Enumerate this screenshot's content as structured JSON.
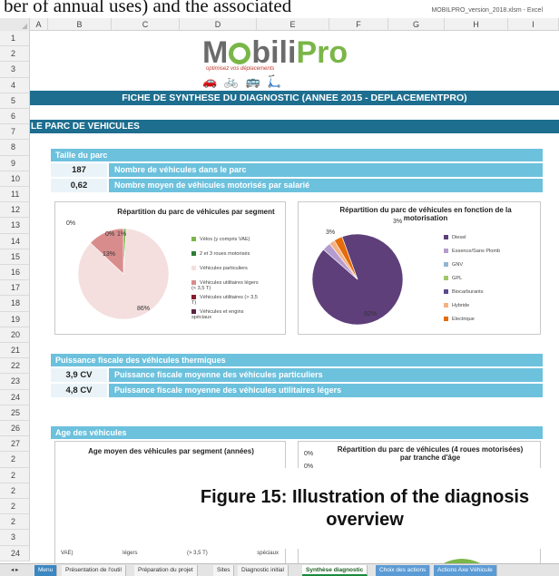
{
  "window": {
    "caption_cut": "ber of annual uses) and the associated",
    "title_text": "MOBILPRO_version_2018.xlsm - Excel"
  },
  "columns": [
    "A",
    "B",
    "C",
    "D",
    "E",
    "F",
    "G",
    "H",
    "I"
  ],
  "rows": [
    "1",
    "2",
    "3",
    "4",
    "5",
    "6",
    "7",
    "8",
    "9",
    "10",
    "11",
    "12",
    "13",
    "14",
    "15",
    "16",
    "17",
    "18",
    "19",
    "20",
    "21",
    "22",
    "23",
    "24",
    "25",
    "26",
    "27",
    "2",
    "2",
    "2",
    "2",
    "2",
    "3",
    "24"
  ],
  "logo": {
    "m": "M",
    "bili": "bili",
    "pro": "Pro",
    "tagline": "optimisez vos déplacements"
  },
  "title_bar": "FICHE DE SYNTHESE DU DIAGNOSTIC (ANNEE 2015 - DEPLACEMENTPRO)",
  "section_parc": "LE PARC DE VEHICULES",
  "taille": {
    "header": "Taille du parc",
    "rows": [
      {
        "value": "187",
        "label": "Nombre de véhicules dans le parc"
      },
      {
        "value": "0,62",
        "label": "Nombre moyen de véhicules motorisés par salarié"
      }
    ]
  },
  "puissance": {
    "header": "Puissance fiscale des véhicules thermiques",
    "rows": [
      {
        "value": "3,9 CV",
        "label": "Puissance fiscale moyenne des véhicules particuliers"
      },
      {
        "value": "4,8 CV",
        "label": "Puissance fiscale moyenne des véhicules utilitaires légers"
      }
    ]
  },
  "age": {
    "header": "Age des véhicules",
    "chart_left_title": "Age moyen des véhicules par segment (années)",
    "chart_right_title": "Répartition du parc de véhicules (4 roues motorisées) par tranche d'âge",
    "right_labels": [
      "0%",
      "0%"
    ],
    "bottom_labels": [
      "VAE)",
      "légers",
      "(> 3,5 T)",
      "spéciaux"
    ]
  },
  "chart_data": [
    {
      "type": "pie",
      "title": "Répartition du parc de véhicules par segment",
      "categories": [
        "Vélos (y compris VAE)",
        "2 et 3 roues motorisés",
        "Véhicules particuliers",
        "Véhicules utilitaires légers (< 3,5 T)",
        "Véhicules utilitaires (> 3,5 T)",
        "Véhicules et engins spéciaux"
      ],
      "values": [
        1,
        0,
        86,
        13,
        0,
        0
      ],
      "labels": [
        "1%",
        "0%",
        "86%",
        "13%",
        "0%",
        "0%"
      ],
      "colors": [
        "#7ab648",
        "#2e7d32",
        "#f4dede",
        "#d98c8c",
        "#8e1b2e",
        "#5b2340"
      ],
      "legend": "right"
    },
    {
      "type": "pie",
      "title": "Répartition du parc de véhicules en fonction de la motorisation",
      "categories": [
        "Diesel",
        "Essence/Sans Plomb",
        "GNV",
        "GPL",
        "Biocarburants",
        "Hybride",
        "Electrique"
      ],
      "values": [
        92,
        3,
        0,
        0,
        0,
        2,
        3
      ],
      "labels": [
        "92%",
        "3%",
        "3%"
      ],
      "colors": [
        "#5e3f7a",
        "#b59ccf",
        "#8fb6d6",
        "#9fc86a",
        "#5b4a8b",
        "#f4b183",
        "#e46c0a"
      ],
      "legend": "right"
    }
  ],
  "overlay": {
    "line1": "Figure 15: Illustration of the diagnosis",
    "line2": "overview"
  },
  "tabs": [
    "Menu",
    "Présentation de l'outil",
    "Préparation du projet",
    "Sites",
    "Diagnostic initial",
    "Synthèse diagnostic",
    "Choix des actions",
    "Actions Axe Véhicule"
  ]
}
